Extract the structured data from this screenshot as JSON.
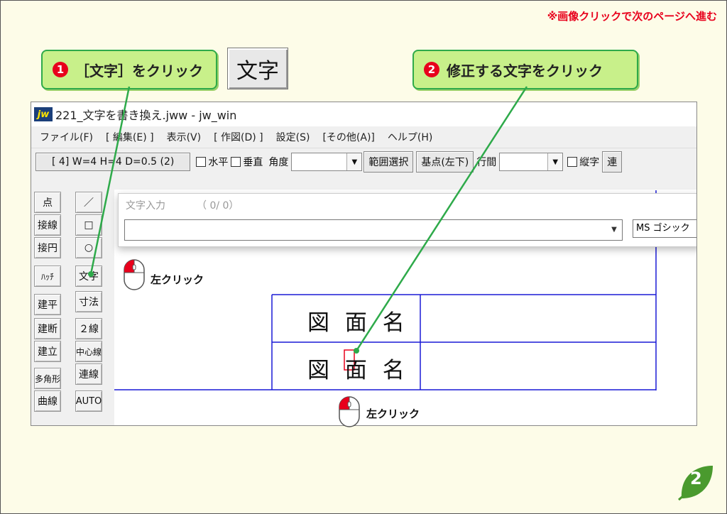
{
  "header": {
    "next_page_note": "※画像クリックで次のページへ進む"
  },
  "callouts": [
    {
      "num": "❶",
      "text": "［文字］をクリック"
    },
    {
      "num": "❷",
      "text": "修正する文字をクリック"
    }
  ],
  "moji_button": {
    "label": "文字"
  },
  "window": {
    "title": "221_文字を書き換え.jww - jw_win",
    "app_icon": "jw",
    "menu": [
      "ファイル(F)",
      "[ 編集(E) ]",
      "表示(V)",
      "[ 作図(D) ]",
      "設定(S)",
      "[その他(A)]",
      "ヘルプ(H)"
    ],
    "toolbar": {
      "layer_info": "[ 4]  W=4  H=4  D=0.5 (2)",
      "horizontal": "水平",
      "vertical": "垂直",
      "angle": "角度",
      "range_select": "範囲選択",
      "base_point": "基点(左下)",
      "line_spacing": "行間",
      "vertical_text": "縦字",
      "continuous": "連"
    },
    "left_col": [
      "点",
      "接線",
      "接円",
      "ﾊｯﾁ",
      "建平",
      "建断",
      "建立",
      "多角形",
      "曲線"
    ],
    "right_col": [
      "／",
      "□",
      "○",
      "文字",
      "寸法",
      "２線",
      "中心線",
      "連線",
      "AUTO"
    ],
    "text_input": {
      "title": "文字入力",
      "counter": "（  0/   0）",
      "value": "",
      "font": "MS ゴシック"
    },
    "drawing": {
      "cell_1": "図 面 名",
      "cell_2": "図 面 名"
    }
  },
  "mouse_labels": [
    "左クリック",
    "左クリック"
  ],
  "page_number": "2",
  "colors": {
    "accent_red": "#e8001c",
    "callout_green": "#c8f08a",
    "callout_border": "#2eaa4a",
    "line_blue": "#1a1ad6",
    "background": "#fdfce8"
  }
}
